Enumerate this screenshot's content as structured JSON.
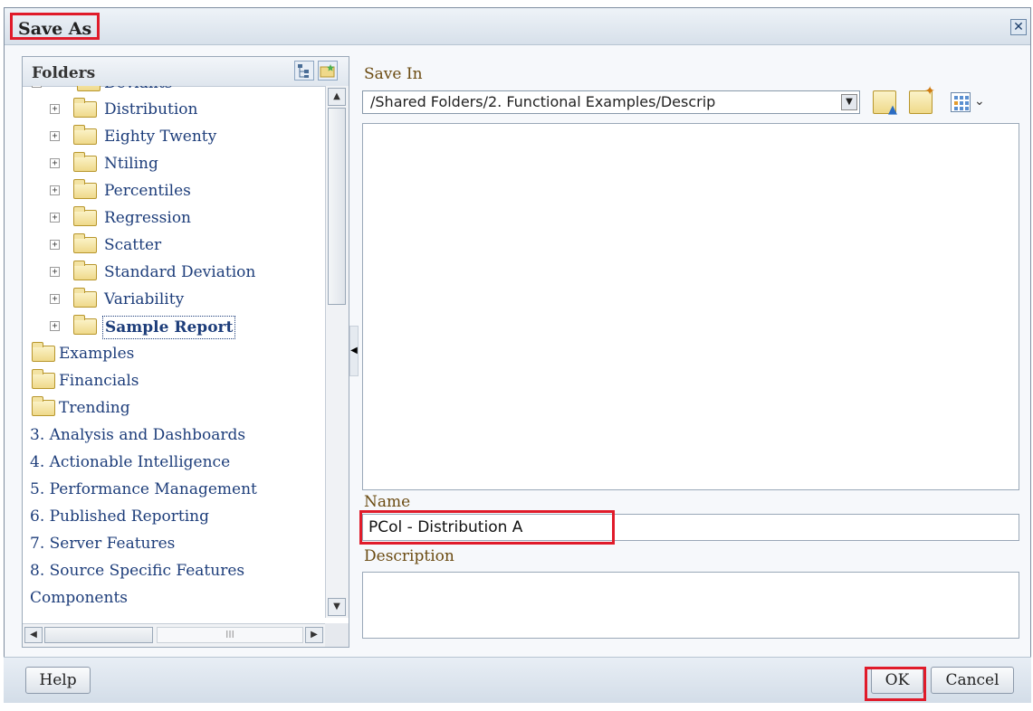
{
  "dialog": {
    "title": "Save As",
    "close_icon": "close-icon",
    "accent_color": "#e01b2a"
  },
  "folders": {
    "header": "Folders",
    "header_icons": [
      "tree-view-icon",
      "favorites-folder-icon"
    ],
    "partial_top_label": "Deviants",
    "items": [
      {
        "label": "Distribution",
        "expander": "+"
      },
      {
        "label": "Eighty Twenty",
        "expander": "+"
      },
      {
        "label": "Ntiling",
        "expander": "+"
      },
      {
        "label": "Percentiles",
        "expander": "+"
      },
      {
        "label": "Regression",
        "expander": "+"
      },
      {
        "label": "Scatter",
        "expander": "+"
      },
      {
        "label": "Standard Deviation",
        "expander": "+"
      },
      {
        "label": "Variability",
        "expander": "+"
      },
      {
        "label": "Sample Report",
        "expander": "+",
        "selected": true
      }
    ],
    "level1_items": [
      "Examples",
      "Financials",
      "Trending"
    ],
    "root_items": [
      "3. Analysis and Dashboards",
      "4. Actionable Intelligence",
      "5. Performance Management",
      "6. Published Reporting",
      "7. Server Features",
      "8. Source Specific Features",
      "Components"
    ],
    "hscroll_track_mark": "III"
  },
  "save_in": {
    "label": "Save In",
    "path": "/Shared Folders/2. Functional Examples/Descrip"
  },
  "name": {
    "label": "Name",
    "value": "PCol - Distribution A"
  },
  "description": {
    "label": "Description",
    "value": ""
  },
  "footer": {
    "help_label": "Help",
    "ok_label": "OK",
    "cancel_label": "Cancel"
  }
}
